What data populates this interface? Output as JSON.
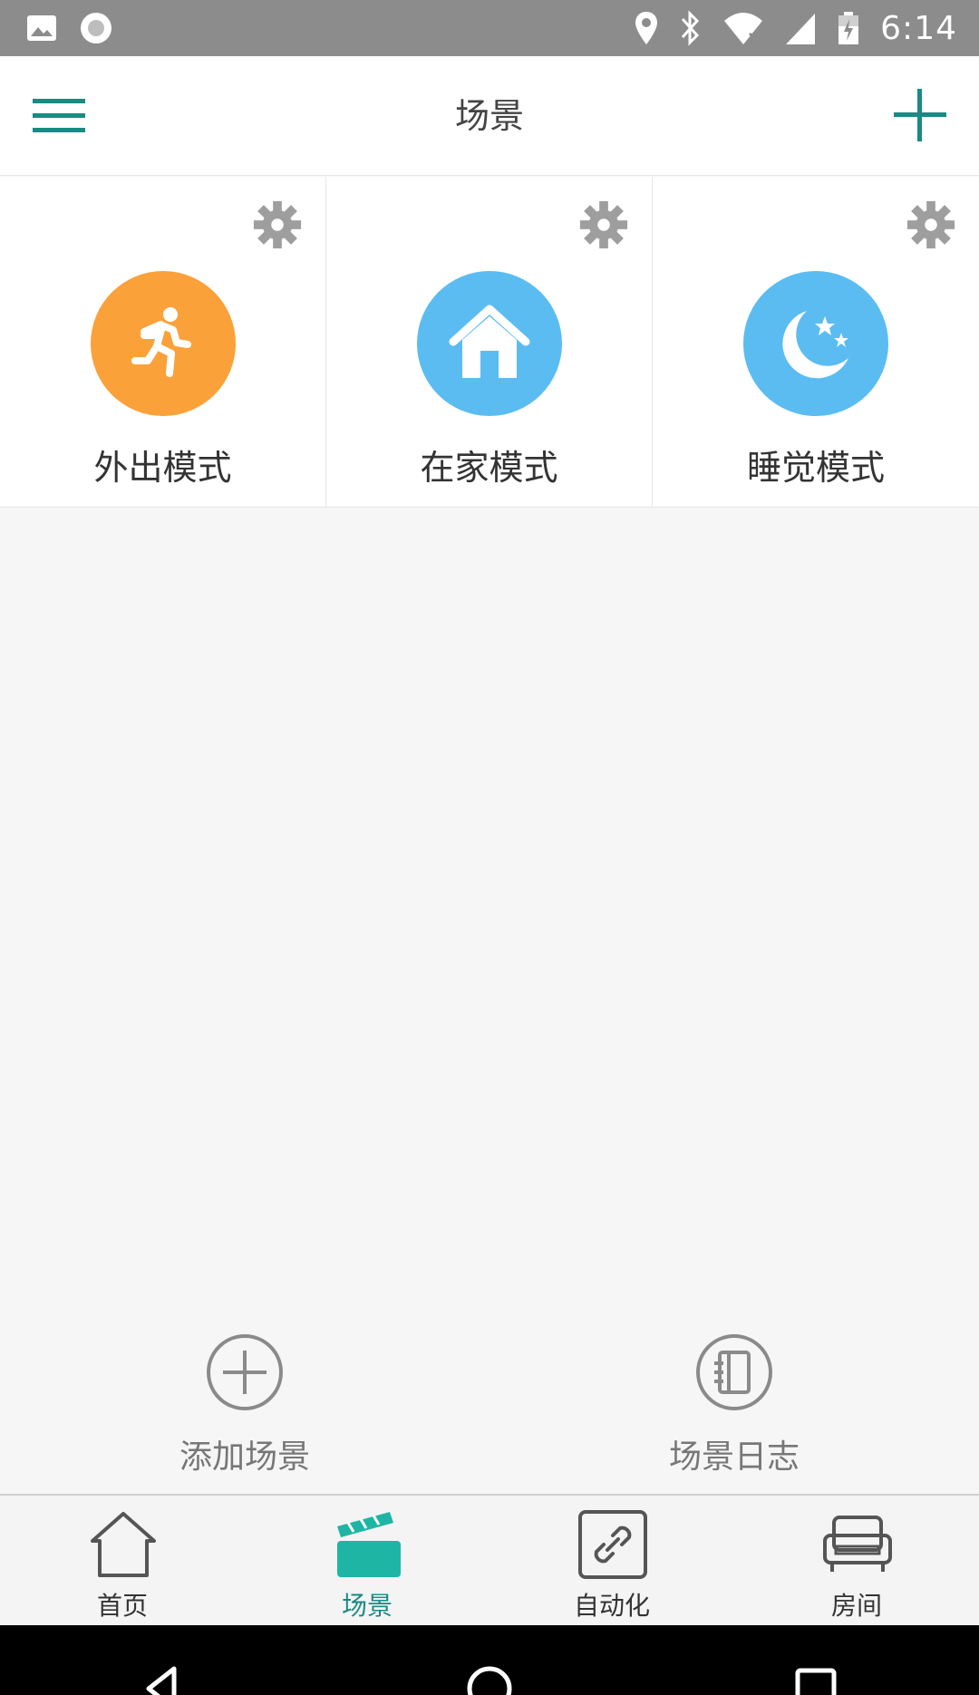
{
  "status_bar": {
    "time": "6:14",
    "icons": [
      "image-icon",
      "record-icon",
      "location-icon",
      "bluetooth-icon",
      "wifi-icon",
      "signal-icon",
      "battery-icon"
    ]
  },
  "header": {
    "title": "场景",
    "menu_icon": "hamburger-icon",
    "add_icon": "plus-icon"
  },
  "scenes": [
    {
      "label": "外出模式",
      "icon": "running-person-icon",
      "color": "#fba13a"
    },
    {
      "label": "在家模式",
      "icon": "house-icon",
      "color": "#5bbcf1"
    },
    {
      "label": "睡觉模式",
      "icon": "moon-stars-icon",
      "color": "#5bbcf1"
    }
  ],
  "actions": {
    "add_scene": "添加场景",
    "scene_log": "场景日志"
  },
  "bottom_nav": {
    "items": [
      {
        "label": "首页",
        "icon": "home-icon"
      },
      {
        "label": "场景",
        "icon": "clapperboard-icon",
        "active": true
      },
      {
        "label": "自动化",
        "icon": "link-icon"
      },
      {
        "label": "房间",
        "icon": "sofa-icon"
      }
    ]
  },
  "colors": {
    "accent": "#1a8a83",
    "scene_active": "#1fb5a5"
  }
}
